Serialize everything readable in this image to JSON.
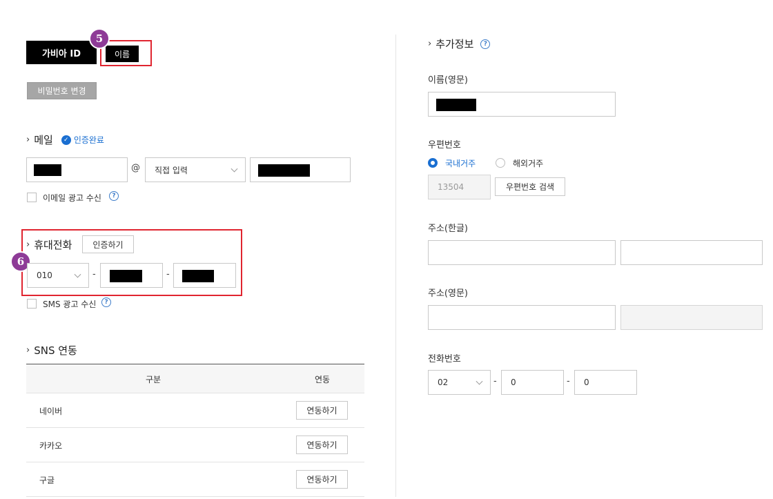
{
  "account": {
    "id_label": "가비아 ID",
    "name_button": "이름",
    "change_password": "비밀번호 변경"
  },
  "badges": {
    "five": "5",
    "six": "6"
  },
  "email": {
    "title": "메일",
    "verified_text": "인증완료",
    "at": "@",
    "domain_select": "직접 입력",
    "ad_checkbox": "이메일 광고 수신"
  },
  "mobile": {
    "title": "휴대전화",
    "verify_button": "인증하기",
    "prefix": "010",
    "dash": "-",
    "sms_checkbox": "SMS 광고 수신"
  },
  "sns": {
    "title": "SNS 연동",
    "headers": [
      "구분",
      "연동"
    ],
    "rows": [
      {
        "name": "네이버",
        "action": "연동하기"
      },
      {
        "name": "카카오",
        "action": "연동하기"
      },
      {
        "name": "구글",
        "action": "연동하기"
      }
    ]
  },
  "extra": {
    "title": "추가정보",
    "name_en_label": "이름(영문)",
    "zip_label": "우편번호",
    "domestic": "국내거주",
    "overseas": "해외거주",
    "zip_value": "13504",
    "zip_search": "우편번호 검색",
    "addr_ko_label": "주소(한글)",
    "addr_en_label": "주소(영문)",
    "phone_label": "전화번호",
    "phone_prefix": "02",
    "phone_mid": "0",
    "phone_last": "0",
    "dash": "-"
  },
  "help_glyph": "?",
  "chevron": "›",
  "colors": {
    "accent": "#1a6fd1",
    "badge": "#8e3b97",
    "highlight": "#e0242f"
  }
}
